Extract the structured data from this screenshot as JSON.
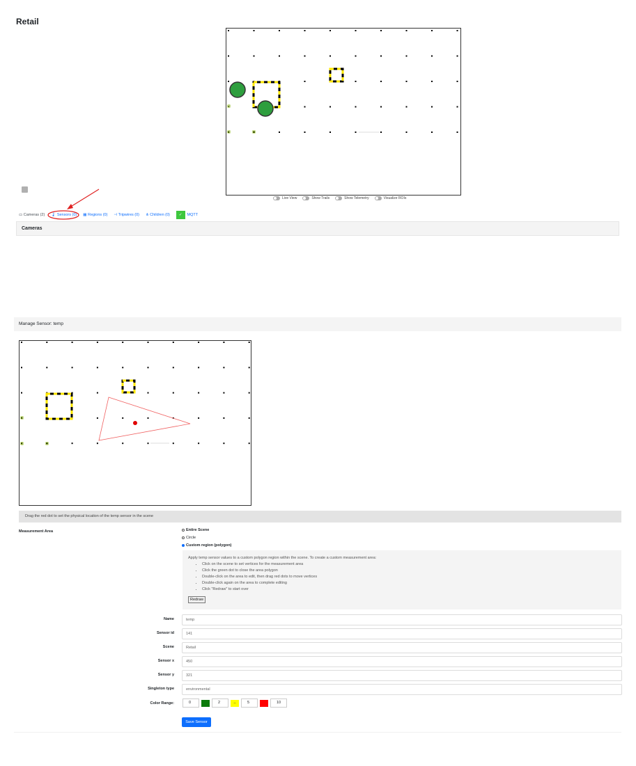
{
  "page": {
    "title": "Retail"
  },
  "scene_toggles": [
    {
      "label": "Live View"
    },
    {
      "label": "Show Trails"
    },
    {
      "label": "Show Telemetry"
    },
    {
      "label": "Visualize ROIs"
    }
  ],
  "tabs": [
    {
      "label": "Cameras (2)",
      "icon": "camera-icon"
    },
    {
      "label": "Sensors (0)",
      "icon": "thermometer-icon"
    },
    {
      "label": "Regions (0)",
      "icon": "regions-icon"
    },
    {
      "label": "Tripwires (0)",
      "icon": "tripwire-icon"
    },
    {
      "label": "Children (0)",
      "icon": "children-icon"
    },
    {
      "label": "MQTT",
      "icon": "mqtt-icon"
    }
  ],
  "cameras_section": {
    "title": "Cameras"
  },
  "manage_sensor": {
    "title": "Manage Sensor: temp",
    "hint": "Drag the red dot to set the physical location of the temp sensor in the scene",
    "measurement_area": {
      "label": "Measurement Area",
      "options": [
        "Entire Scene",
        "Circle",
        "Custom region (polygon)"
      ],
      "selected": "Custom region (polygon)",
      "help_title": "Apply temp sensor values to a custom polygon region within the scene. To create a custom measurement area:",
      "help_steps": [
        "Click on the scene to set vertices for the measurement area",
        "Click the green dot to close the area polygon",
        "Double-click on the area to edit, then drag red dots to move vertices",
        "Double-click again on the area to complete editing",
        "Click \"Redraw\" to start over"
      ],
      "redraw_label": "Redraw"
    },
    "fields": [
      {
        "label": "Name",
        "value": "temp"
      },
      {
        "label": "Sensor id",
        "value": "141"
      },
      {
        "label": "Scene",
        "value": "Retail"
      },
      {
        "label": "Sensor x",
        "value": "450"
      },
      {
        "label": "Sensor y",
        "value": "321"
      },
      {
        "label": "Singleton type",
        "value": "environmental"
      }
    ],
    "color_range": {
      "label": "Color Range:",
      "values": [
        "0",
        "2",
        "5",
        "10"
      ],
      "colors": [
        "#0a7a0a",
        "#ffff00",
        "#ff0000"
      ]
    },
    "save_label": "Save Sensor"
  },
  "colors": {
    "accent": "#0d6efd",
    "mqtt": "#3ec73e",
    "object": "#2e9e3e",
    "roi_yellow": "#ffe600",
    "sensor_red": "#ff0000"
  }
}
